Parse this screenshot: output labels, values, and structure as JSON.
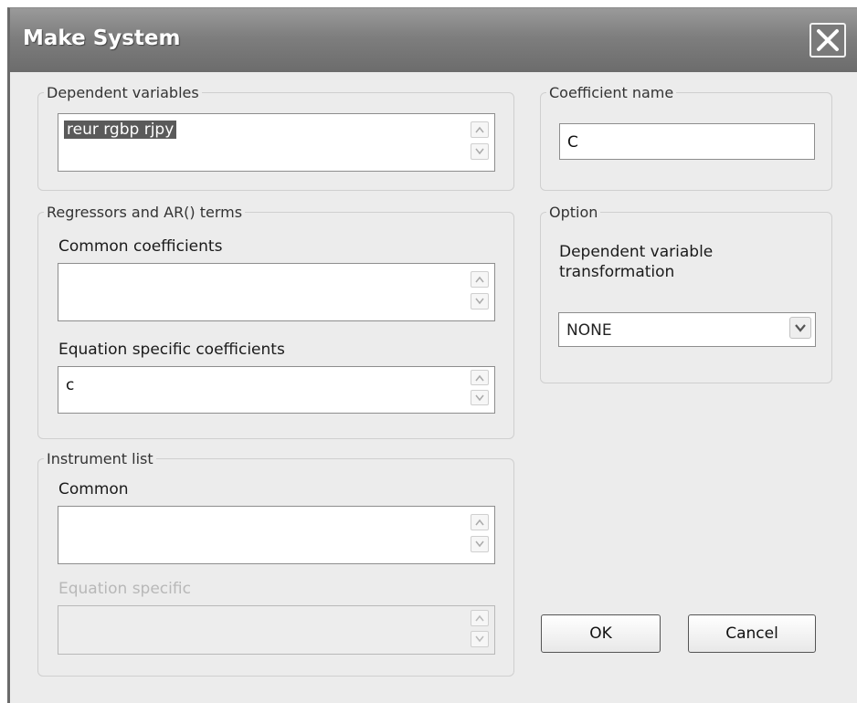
{
  "window": {
    "title": "Make System"
  },
  "dependent_variables": {
    "legend": "Dependent variables",
    "value": "reur rgbp rjpy"
  },
  "coefficient_name": {
    "legend": "Coefficient name",
    "value": "C"
  },
  "regressors": {
    "legend": "Regressors and AR() terms",
    "common_label": "Common coefficients",
    "common_value": "",
    "specific_label": "Equation specific coefficients",
    "specific_value": "c"
  },
  "option": {
    "legend": "Option",
    "label": "Dependent variable transformation",
    "selected": "NONE"
  },
  "instruments": {
    "legend": "Instrument list",
    "common_label": "Common",
    "common_value": "",
    "specific_label": "Equation specific",
    "specific_value": ""
  },
  "buttons": {
    "ok": "OK",
    "cancel": "Cancel"
  },
  "icons": {
    "close": "close-icon",
    "scroll_up": "scroll-up-icon",
    "scroll_down": "scroll-down-icon",
    "dropdown": "chevron-down-icon"
  }
}
